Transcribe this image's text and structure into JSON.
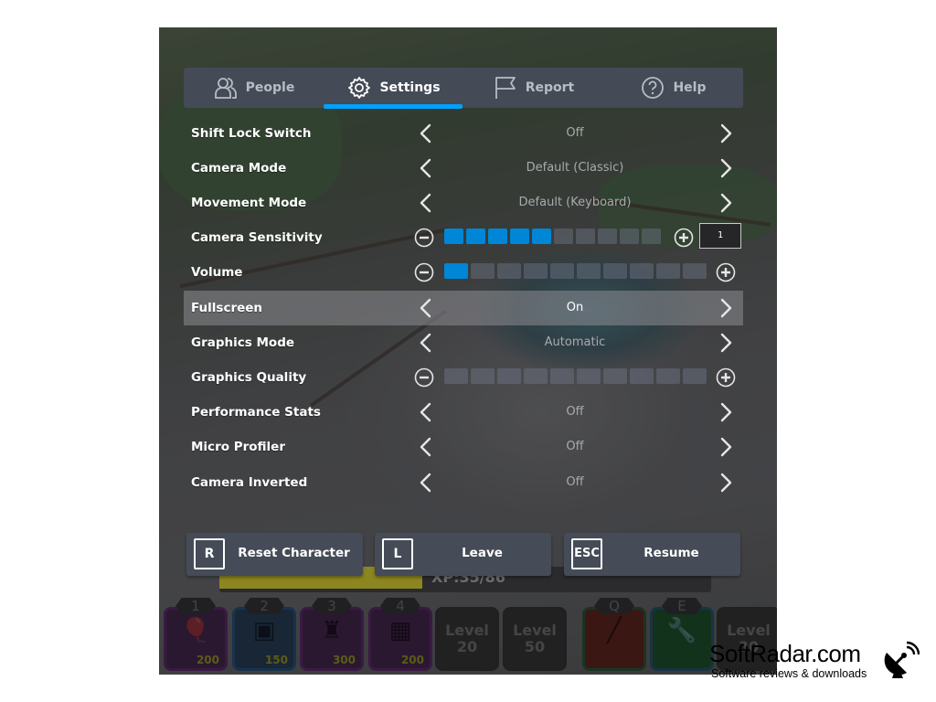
{
  "tabs": [
    {
      "label": "People",
      "icon": "people-icon",
      "active": false
    },
    {
      "label": "Settings",
      "icon": "gear-icon",
      "active": true
    },
    {
      "label": "Report",
      "icon": "flag-icon",
      "active": false
    },
    {
      "label": "Help",
      "icon": "help-icon",
      "active": false
    }
  ],
  "settings": [
    {
      "label": "Shift Lock Switch",
      "type": "selector",
      "value": "Off"
    },
    {
      "label": "Camera Mode",
      "type": "selector",
      "value": "Default (Classic)"
    },
    {
      "label": "Movement Mode",
      "type": "selector",
      "value": "Default (Keyboard)"
    },
    {
      "label": "Camera Sensitivity",
      "type": "slider",
      "level": 5,
      "max": 10,
      "input_value": "1"
    },
    {
      "label": "Volume",
      "type": "slider",
      "level": 1,
      "max": 10
    },
    {
      "label": "Fullscreen",
      "type": "selector",
      "value": "On",
      "highlighted": true
    },
    {
      "label": "Graphics Mode",
      "type": "selector",
      "value": "Automatic"
    },
    {
      "label": "Graphics Quality",
      "type": "slider",
      "level": 0,
      "max": 10,
      "disabled": true
    },
    {
      "label": "Performance Stats",
      "type": "selector",
      "value": "Off"
    },
    {
      "label": "Micro Profiler",
      "type": "selector",
      "value": "Off"
    },
    {
      "label": "Camera Inverted",
      "type": "selector",
      "value": "Off"
    }
  ],
  "actions": [
    {
      "key": "R",
      "label": "Reset Character"
    },
    {
      "key": "L",
      "label": "Leave"
    },
    {
      "key": "ESC",
      "label": "Resume"
    }
  ],
  "background_hud": {
    "xp_text": "XP:35/86",
    "hotbar": [
      {
        "key": "1",
        "cost": "200",
        "icon": "hot-air-balloon-icon"
      },
      {
        "key": "2",
        "cost": "150",
        "icon": "birdhouse-icon"
      },
      {
        "key": "3",
        "cost": "300",
        "icon": "watchtower-icon"
      },
      {
        "key": "4",
        "cost": "200",
        "icon": "stone-tower-icon"
      },
      {
        "locked_label": "Level",
        "locked_level": "20"
      },
      {
        "locked_label": "Level",
        "locked_level": "50"
      },
      {
        "key": "Q",
        "icon": "dynamite-icon"
      },
      {
        "key": "E",
        "icon": "wrench-icon"
      },
      {
        "locked_label": "Level",
        "locked_level": "30"
      }
    ]
  },
  "watermark": {
    "title": "SoftRadar.com",
    "subtitle": "Software reviews & downloads"
  },
  "colors": {
    "accent": "#00a2ff",
    "slider_on": "#0086d6",
    "panel": "#444a56"
  }
}
